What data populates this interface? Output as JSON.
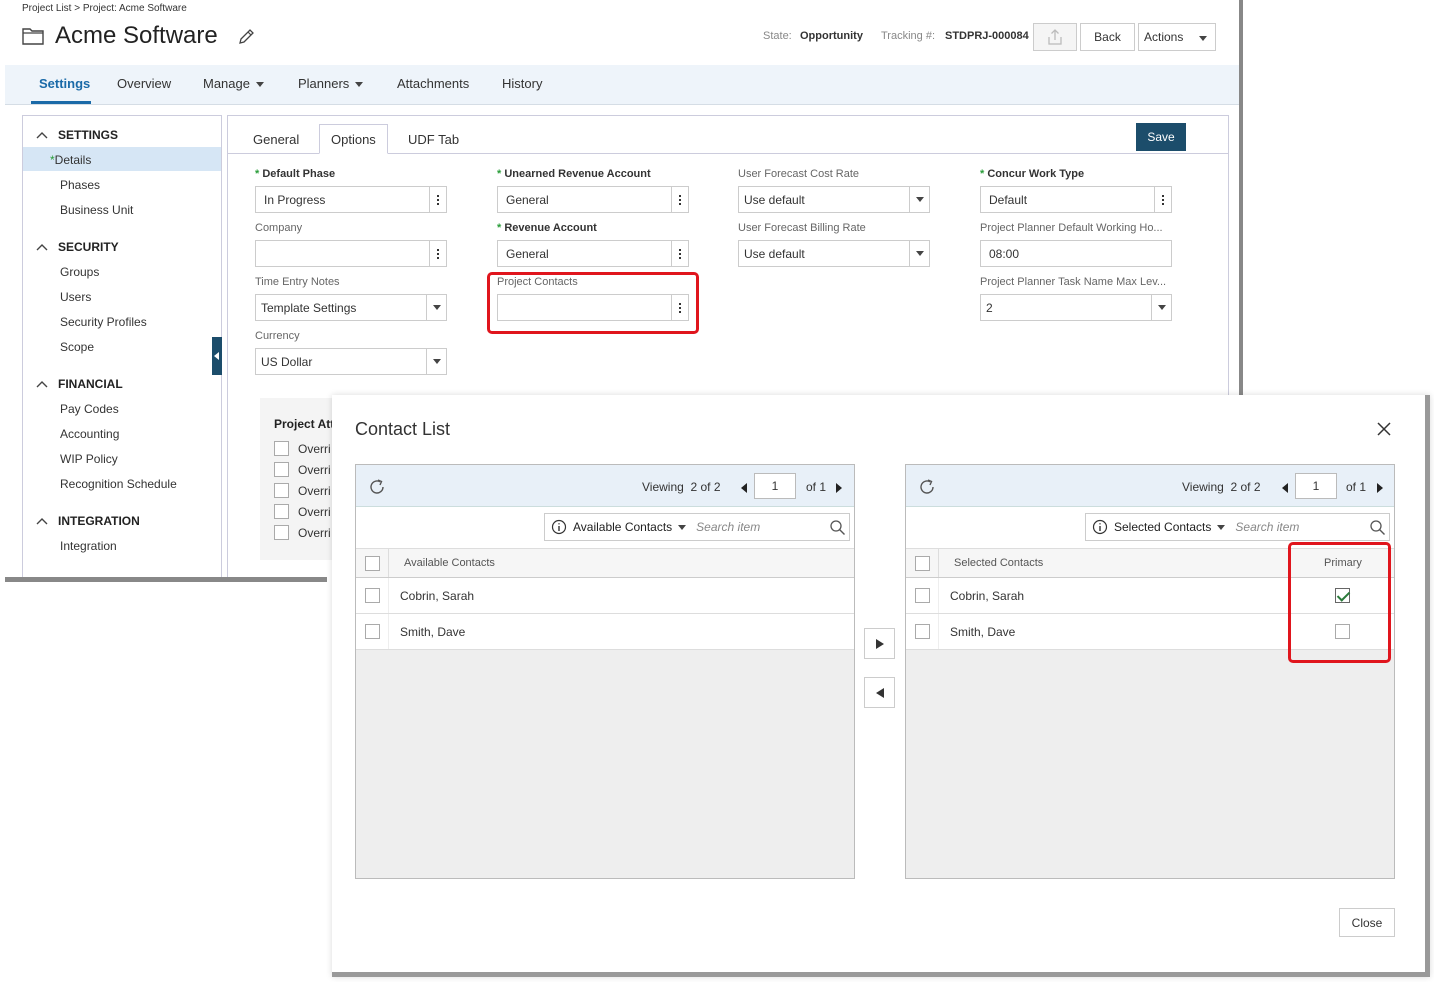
{
  "app": {
    "breadcrumb": "Project List > Project: Acme Software",
    "title": "Acme Software",
    "state_label": "State:",
    "state_value": "Opportunity",
    "tracking_label": "Tracking #:",
    "tracking_value": "STDPRJ-000084",
    "back_label": "Back",
    "actions_label": "Actions"
  },
  "nav": {
    "items": [
      "Settings",
      "Overview",
      "Manage",
      "Planners",
      "Attachments",
      "History"
    ],
    "active": "Settings"
  },
  "sidebar": {
    "sections": [
      {
        "label": "SETTINGS",
        "items": [
          "Details",
          "Phases",
          "Business Unit"
        ]
      },
      {
        "label": "SECURITY",
        "items": [
          "Groups",
          "Users",
          "Security Profiles",
          "Scope"
        ]
      },
      {
        "label": "FINANCIAL",
        "items": [
          "Pay Codes",
          "Accounting",
          "WIP Policy",
          "Recognition Schedule"
        ]
      },
      {
        "label": "INTEGRATION",
        "items": [
          "Integration"
        ]
      }
    ],
    "selected": "Details",
    "selected_marker": "*"
  },
  "main": {
    "tabs": [
      "General",
      "Options",
      "UDF Tab"
    ],
    "active_tab": "Options",
    "save_label": "Save",
    "required_marker": "*",
    "fields": {
      "default_phase": {
        "label": "Default Phase",
        "value": "In Progress"
      },
      "company": {
        "label": "Company",
        "value": ""
      },
      "time_entry_notes": {
        "label": "Time Entry Notes",
        "value": "Template Settings"
      },
      "currency": {
        "label": "Currency",
        "value": "US Dollar"
      },
      "unearned_revenue_account": {
        "label": "Unearned Revenue Account",
        "value": "General"
      },
      "revenue_account": {
        "label": "Revenue Account",
        "value": "General"
      },
      "project_contacts": {
        "label": "Project Contacts",
        "value": ""
      },
      "user_forecast_cost_rate": {
        "label": "User Forecast Cost Rate",
        "value": "Use default"
      },
      "user_forecast_billing_rate": {
        "label": "User Forecast Billing Rate",
        "value": "Use default"
      },
      "concur_work_type": {
        "label": "Concur Work Type",
        "value": "Default"
      },
      "planner_working_hours": {
        "label": "Project Planner Default Working Ho...",
        "value": "08:00"
      },
      "planner_task_name_max": {
        "label": "Project Planner Task Name Max Lev...",
        "value": "2"
      }
    },
    "attributes": {
      "title": "Project Att",
      "rows": [
        "Overri",
        "Overri",
        "Overri",
        "Overri",
        "Overri"
      ]
    }
  },
  "dialog": {
    "title": "Contact List",
    "close_label": "Close",
    "available": {
      "viewing_prefix": "Viewing",
      "viewing_count": "2 of 2",
      "page": "1",
      "of_pages": "of 1",
      "filter_label": "Available Contacts",
      "search_placeholder": "Search item",
      "column": "Available Contacts",
      "rows": [
        "Cobrin, Sarah",
        "Smith, Dave"
      ]
    },
    "selected": {
      "viewing_prefix": "Viewing",
      "viewing_count": "2 of 2",
      "page": "1",
      "of_pages": "of 1",
      "filter_label": "Selected Contacts",
      "search_placeholder": "Search item",
      "column": "Selected Contacts",
      "primary_column": "Primary",
      "rows": [
        {
          "name": "Cobrin, Sarah",
          "primary": true
        },
        {
          "name": "Smith, Dave",
          "primary": false
        }
      ]
    }
  },
  "colors": {
    "accent": "#1a6aa8",
    "save_button": "#1c4d6b",
    "highlight": "#e0151d",
    "required": "#2a9d3a"
  }
}
